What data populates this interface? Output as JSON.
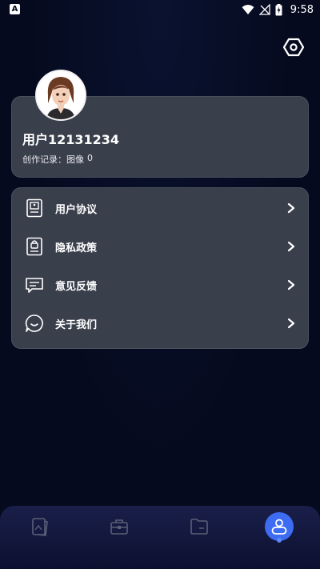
{
  "status_bar": {
    "left_icon_letter": "A",
    "time": "9:58",
    "icons": [
      "wifi-icon",
      "signal-off-icon",
      "battery-charging-icon"
    ]
  },
  "settings": {
    "icon": "settings-hexagon-icon"
  },
  "profile": {
    "username": "用户12131234",
    "record_label": "创作记录：",
    "image_label": "图像",
    "image_count": "0",
    "avatar": "cartoon-girl-avatar"
  },
  "menu": {
    "items": [
      {
        "label": "用户协议",
        "icon": "document-user-icon"
      },
      {
        "label": "隐私政策",
        "icon": "document-lock-icon"
      },
      {
        "label": "意见反馈",
        "icon": "message-icon"
      },
      {
        "label": "关于我们",
        "icon": "chat-bubble-icon"
      }
    ]
  },
  "bottom_nav": {
    "items": [
      "gallery-icon",
      "toolbox-icon",
      "folder-icon",
      "profile-icon"
    ],
    "active_index": 3
  },
  "colors": {
    "background": "#050a1e",
    "card": "#3a3f4c",
    "accent": "#3d6cf2"
  }
}
